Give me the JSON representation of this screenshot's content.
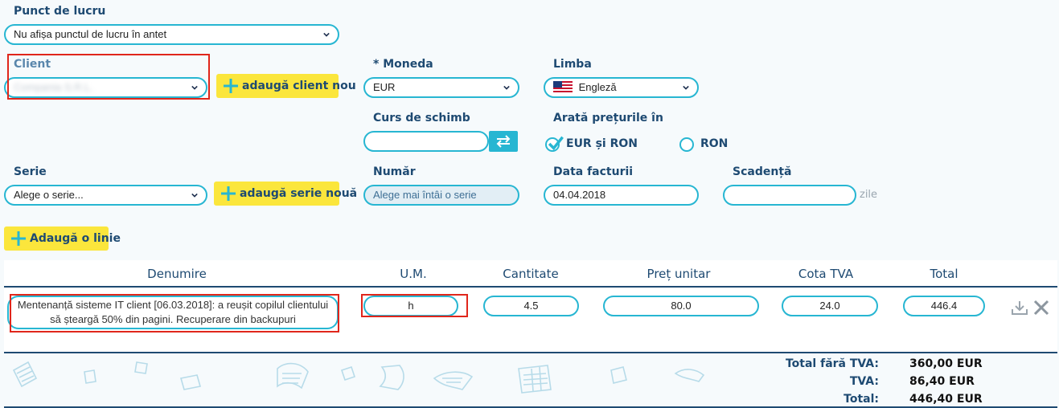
{
  "workplace": {
    "label": "Punct de lucru",
    "value": "Nu afișa punctul de lucru în antet"
  },
  "client": {
    "label": "Client",
    "value": "Compania S.R.L.",
    "add_button": "adaugă client nou"
  },
  "currency": {
    "label": "* Moneda",
    "value": "EUR"
  },
  "language": {
    "label": "Limba",
    "value": "Engleză",
    "flag": "us-flag-icon"
  },
  "exchange_rate": {
    "label": "Curs de schimb",
    "value": "",
    "swap_icon": "swap-arrows-icon"
  },
  "show_prices": {
    "label": "Arată prețurile în",
    "options": [
      {
        "label": "EUR și RON",
        "checked": true
      },
      {
        "label": "RON",
        "checked": false
      }
    ]
  },
  "series": {
    "label": "Serie",
    "value": "Alege o serie...",
    "add_button": "adaugă serie nouă"
  },
  "number": {
    "label": "Număr",
    "placeholder": "Alege mai întâi o serie"
  },
  "invoice_date": {
    "label": "Data facturii",
    "value": "04.04.2018"
  },
  "due": {
    "label": "Scadență",
    "value": "",
    "unit": "zile"
  },
  "add_line_button": "Adaugă o linie",
  "table": {
    "headers": [
      "Denumire",
      "U.M.",
      "Cantitate",
      "Preț unitar",
      "Cota TVA",
      "Total"
    ],
    "rows": [
      {
        "description": "Mentenanță sisteme IT client [06.03.2018]: a reușit copilul clientului să șteargă 50% din pagini. Recuperare din backupuri",
        "unit": "h",
        "quantity": "4.5",
        "unit_price": "80.0",
        "vat": "24.0",
        "total": "446.4"
      }
    ]
  },
  "totals": {
    "without_vat_label": "Total fără TVA:",
    "without_vat_value": "360,00 EUR",
    "vat_label": "TVA:",
    "vat_value": "86,40 EUR",
    "total_label": "Total:",
    "total_value": "446,40 EUR"
  },
  "colors": {
    "accent": "#27b6d2",
    "label": "#1e4a72",
    "button_yellow": "#fbe63c",
    "highlight_red": "#e0261b"
  }
}
